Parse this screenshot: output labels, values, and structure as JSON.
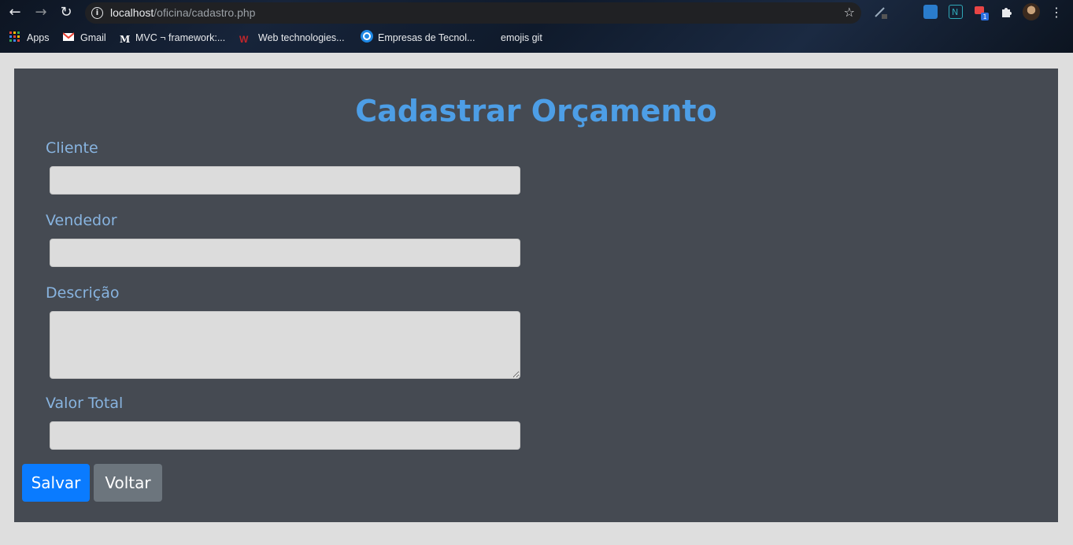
{
  "browser": {
    "url_host": "localhost",
    "url_path": "/oficina/cadastro.php",
    "bookmarks": [
      {
        "label": "Apps",
        "icon": "apps-grid-icon"
      },
      {
        "label": "Gmail",
        "icon": "gmail-icon"
      },
      {
        "label": "MVC ¬ framework:...",
        "icon": "medium-icon"
      },
      {
        "label": "Web technologies...",
        "icon": "w3schools-icon"
      },
      {
        "label": "Empresas de Tecnol...",
        "icon": "gear-circle-icon"
      },
      {
        "label": "emojis git",
        "icon": "blank-page-icon"
      }
    ],
    "extension_badge": "1"
  },
  "form": {
    "title": "Cadastrar Orçamento",
    "fields": [
      {
        "label": "Cliente",
        "value": ""
      },
      {
        "label": "Vendedor",
        "value": ""
      },
      {
        "label": "Descrição",
        "value": ""
      },
      {
        "label": "Valor Total",
        "value": ""
      }
    ],
    "save_label": "Salvar",
    "back_label": "Voltar"
  },
  "colors": {
    "title": "#4d9ee6",
    "label": "#88b4e0",
    "panel": "#454a52",
    "save_button": "#0a7bff",
    "back_button": "#6c757d"
  }
}
